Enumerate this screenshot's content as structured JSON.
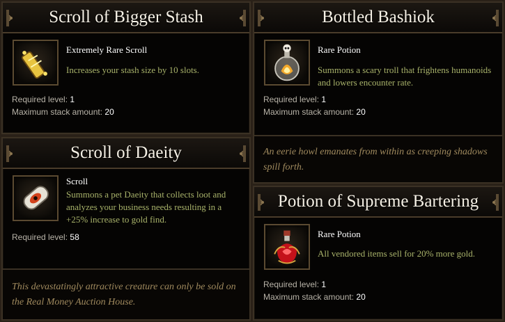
{
  "cards": [
    {
      "title": "Scroll of Bigger Stash",
      "item_type": "Extremely Rare Scroll",
      "description": "Increases your stash size by 10 slots.",
      "stats": [
        {
          "label": "Required level:",
          "value": "1"
        },
        {
          "label": "Maximum stack amount:",
          "value": "20"
        }
      ],
      "icon": "golden-scroll-icon"
    },
    {
      "title": "Scroll of Daeity",
      "item_type": "Scroll",
      "description": "Summons a pet Daeity that collects loot and analyzes your business needs resulting in a +25% increase to gold find.",
      "stats": [
        {
          "label": "Required level:",
          "value": "58"
        }
      ],
      "flavor": "This devastatingly attractive creature can only be sold on the Real Money Auction House.",
      "icon": "eye-scroll-icon"
    },
    {
      "title": "Bottled Bashiok",
      "item_type": "Rare Potion",
      "description": "Summons a scary troll that frightens humanoids and lowers encounter rate.",
      "stats": [
        {
          "label": "Required level:",
          "value": "1"
        },
        {
          "label": "Maximum stack amount:",
          "value": "20"
        }
      ],
      "flavor": "An eerie howl emanates from within as creeping shadows spill forth.",
      "icon": "skull-bottle-icon"
    },
    {
      "title": "Potion of Supreme Bartering",
      "item_type": "Rare Potion",
      "description": "All vendored items sell for 20% more gold.",
      "stats": [
        {
          "label": "Required level:",
          "value": "1"
        },
        {
          "label": "Maximum stack amount:",
          "value": "20"
        }
      ],
      "icon": "red-potion-icon"
    }
  ],
  "colors": {
    "title": "#f6f1e6",
    "item_type": "#ffffff",
    "description": "#a8b26a",
    "stat_label": "#b8b3a8",
    "flavor": "#a08a5e",
    "frame": "#3b3124",
    "background": "#050403"
  }
}
